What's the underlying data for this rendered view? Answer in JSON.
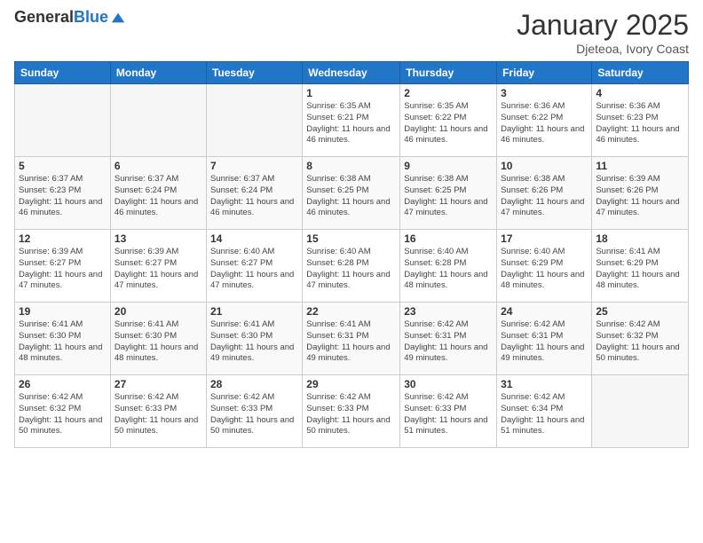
{
  "logo": {
    "general": "General",
    "blue": "Blue"
  },
  "header": {
    "month": "January 2025",
    "location": "Djeteoa, Ivory Coast"
  },
  "weekdays": [
    "Sunday",
    "Monday",
    "Tuesday",
    "Wednesday",
    "Thursday",
    "Friday",
    "Saturday"
  ],
  "weeks": [
    [
      {
        "day": "",
        "sunrise": "",
        "sunset": "",
        "daylight": ""
      },
      {
        "day": "",
        "sunrise": "",
        "sunset": "",
        "daylight": ""
      },
      {
        "day": "",
        "sunrise": "",
        "sunset": "",
        "daylight": ""
      },
      {
        "day": "1",
        "sunrise": "Sunrise: 6:35 AM",
        "sunset": "Sunset: 6:21 PM",
        "daylight": "Daylight: 11 hours and 46 minutes."
      },
      {
        "day": "2",
        "sunrise": "Sunrise: 6:35 AM",
        "sunset": "Sunset: 6:22 PM",
        "daylight": "Daylight: 11 hours and 46 minutes."
      },
      {
        "day": "3",
        "sunrise": "Sunrise: 6:36 AM",
        "sunset": "Sunset: 6:22 PM",
        "daylight": "Daylight: 11 hours and 46 minutes."
      },
      {
        "day": "4",
        "sunrise": "Sunrise: 6:36 AM",
        "sunset": "Sunset: 6:23 PM",
        "daylight": "Daylight: 11 hours and 46 minutes."
      }
    ],
    [
      {
        "day": "5",
        "sunrise": "Sunrise: 6:37 AM",
        "sunset": "Sunset: 6:23 PM",
        "daylight": "Daylight: 11 hours and 46 minutes."
      },
      {
        "day": "6",
        "sunrise": "Sunrise: 6:37 AM",
        "sunset": "Sunset: 6:24 PM",
        "daylight": "Daylight: 11 hours and 46 minutes."
      },
      {
        "day": "7",
        "sunrise": "Sunrise: 6:37 AM",
        "sunset": "Sunset: 6:24 PM",
        "daylight": "Daylight: 11 hours and 46 minutes."
      },
      {
        "day": "8",
        "sunrise": "Sunrise: 6:38 AM",
        "sunset": "Sunset: 6:25 PM",
        "daylight": "Daylight: 11 hours and 46 minutes."
      },
      {
        "day": "9",
        "sunrise": "Sunrise: 6:38 AM",
        "sunset": "Sunset: 6:25 PM",
        "daylight": "Daylight: 11 hours and 47 minutes."
      },
      {
        "day": "10",
        "sunrise": "Sunrise: 6:38 AM",
        "sunset": "Sunset: 6:26 PM",
        "daylight": "Daylight: 11 hours and 47 minutes."
      },
      {
        "day": "11",
        "sunrise": "Sunrise: 6:39 AM",
        "sunset": "Sunset: 6:26 PM",
        "daylight": "Daylight: 11 hours and 47 minutes."
      }
    ],
    [
      {
        "day": "12",
        "sunrise": "Sunrise: 6:39 AM",
        "sunset": "Sunset: 6:27 PM",
        "daylight": "Daylight: 11 hours and 47 minutes."
      },
      {
        "day": "13",
        "sunrise": "Sunrise: 6:39 AM",
        "sunset": "Sunset: 6:27 PM",
        "daylight": "Daylight: 11 hours and 47 minutes."
      },
      {
        "day": "14",
        "sunrise": "Sunrise: 6:40 AM",
        "sunset": "Sunset: 6:27 PM",
        "daylight": "Daylight: 11 hours and 47 minutes."
      },
      {
        "day": "15",
        "sunrise": "Sunrise: 6:40 AM",
        "sunset": "Sunset: 6:28 PM",
        "daylight": "Daylight: 11 hours and 47 minutes."
      },
      {
        "day": "16",
        "sunrise": "Sunrise: 6:40 AM",
        "sunset": "Sunset: 6:28 PM",
        "daylight": "Daylight: 11 hours and 48 minutes."
      },
      {
        "day": "17",
        "sunrise": "Sunrise: 6:40 AM",
        "sunset": "Sunset: 6:29 PM",
        "daylight": "Daylight: 11 hours and 48 minutes."
      },
      {
        "day": "18",
        "sunrise": "Sunrise: 6:41 AM",
        "sunset": "Sunset: 6:29 PM",
        "daylight": "Daylight: 11 hours and 48 minutes."
      }
    ],
    [
      {
        "day": "19",
        "sunrise": "Sunrise: 6:41 AM",
        "sunset": "Sunset: 6:30 PM",
        "daylight": "Daylight: 11 hours and 48 minutes."
      },
      {
        "day": "20",
        "sunrise": "Sunrise: 6:41 AM",
        "sunset": "Sunset: 6:30 PM",
        "daylight": "Daylight: 11 hours and 48 minutes."
      },
      {
        "day": "21",
        "sunrise": "Sunrise: 6:41 AM",
        "sunset": "Sunset: 6:30 PM",
        "daylight": "Daylight: 11 hours and 49 minutes."
      },
      {
        "day": "22",
        "sunrise": "Sunrise: 6:41 AM",
        "sunset": "Sunset: 6:31 PM",
        "daylight": "Daylight: 11 hours and 49 minutes."
      },
      {
        "day": "23",
        "sunrise": "Sunrise: 6:42 AM",
        "sunset": "Sunset: 6:31 PM",
        "daylight": "Daylight: 11 hours and 49 minutes."
      },
      {
        "day": "24",
        "sunrise": "Sunrise: 6:42 AM",
        "sunset": "Sunset: 6:31 PM",
        "daylight": "Daylight: 11 hours and 49 minutes."
      },
      {
        "day": "25",
        "sunrise": "Sunrise: 6:42 AM",
        "sunset": "Sunset: 6:32 PM",
        "daylight": "Daylight: 11 hours and 50 minutes."
      }
    ],
    [
      {
        "day": "26",
        "sunrise": "Sunrise: 6:42 AM",
        "sunset": "Sunset: 6:32 PM",
        "daylight": "Daylight: 11 hours and 50 minutes."
      },
      {
        "day": "27",
        "sunrise": "Sunrise: 6:42 AM",
        "sunset": "Sunset: 6:33 PM",
        "daylight": "Daylight: 11 hours and 50 minutes."
      },
      {
        "day": "28",
        "sunrise": "Sunrise: 6:42 AM",
        "sunset": "Sunset: 6:33 PM",
        "daylight": "Daylight: 11 hours and 50 minutes."
      },
      {
        "day": "29",
        "sunrise": "Sunrise: 6:42 AM",
        "sunset": "Sunset: 6:33 PM",
        "daylight": "Daylight: 11 hours and 50 minutes."
      },
      {
        "day": "30",
        "sunrise": "Sunrise: 6:42 AM",
        "sunset": "Sunset: 6:33 PM",
        "daylight": "Daylight: 11 hours and 51 minutes."
      },
      {
        "day": "31",
        "sunrise": "Sunrise: 6:42 AM",
        "sunset": "Sunset: 6:34 PM",
        "daylight": "Daylight: 11 hours and 51 minutes."
      },
      {
        "day": "",
        "sunrise": "",
        "sunset": "",
        "daylight": ""
      }
    ]
  ]
}
